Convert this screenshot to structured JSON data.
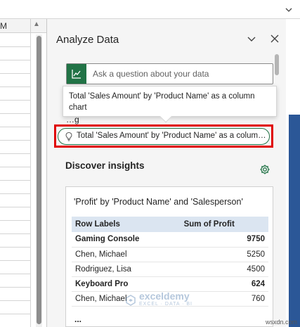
{
  "sheet": {
    "column_letter": "M"
  },
  "pane": {
    "title": "Analyze Data",
    "ask_placeholder": "Ask a question about your data",
    "tooltip": "Total 'Sales Amount' by 'Product Name' as a column chart",
    "suggestion": "Total 'Sales Amount' by 'Product Name' as a column chart",
    "behind_text": "…g",
    "discover_heading": "Discover insights"
  },
  "card": {
    "title": "'Profit' by 'Product Name' and 'Salesperson'",
    "headers": [
      "Row Labels",
      "Sum of Profit"
    ],
    "rows": [
      {
        "label": "Gaming Console",
        "value": "9750",
        "group": true
      },
      {
        "label": "Chen, Michael",
        "value": "5250",
        "group": false
      },
      {
        "label": "Rodriguez, Lisa",
        "value": "4500",
        "group": false
      },
      {
        "label": "Keyboard Pro",
        "value": "624",
        "group": true
      },
      {
        "label": "Chen, Michael",
        "value": "760",
        "group": false
      }
    ],
    "ellipsis": "..."
  },
  "watermark": {
    "name": "exceldemy",
    "tagline": "EXCEL · DATA · BI"
  },
  "site_mark": "wsxdn.com",
  "colors": {
    "excel_green": "#217346",
    "highlight_red": "#e00000",
    "table_header": "#dbe5f1"
  }
}
